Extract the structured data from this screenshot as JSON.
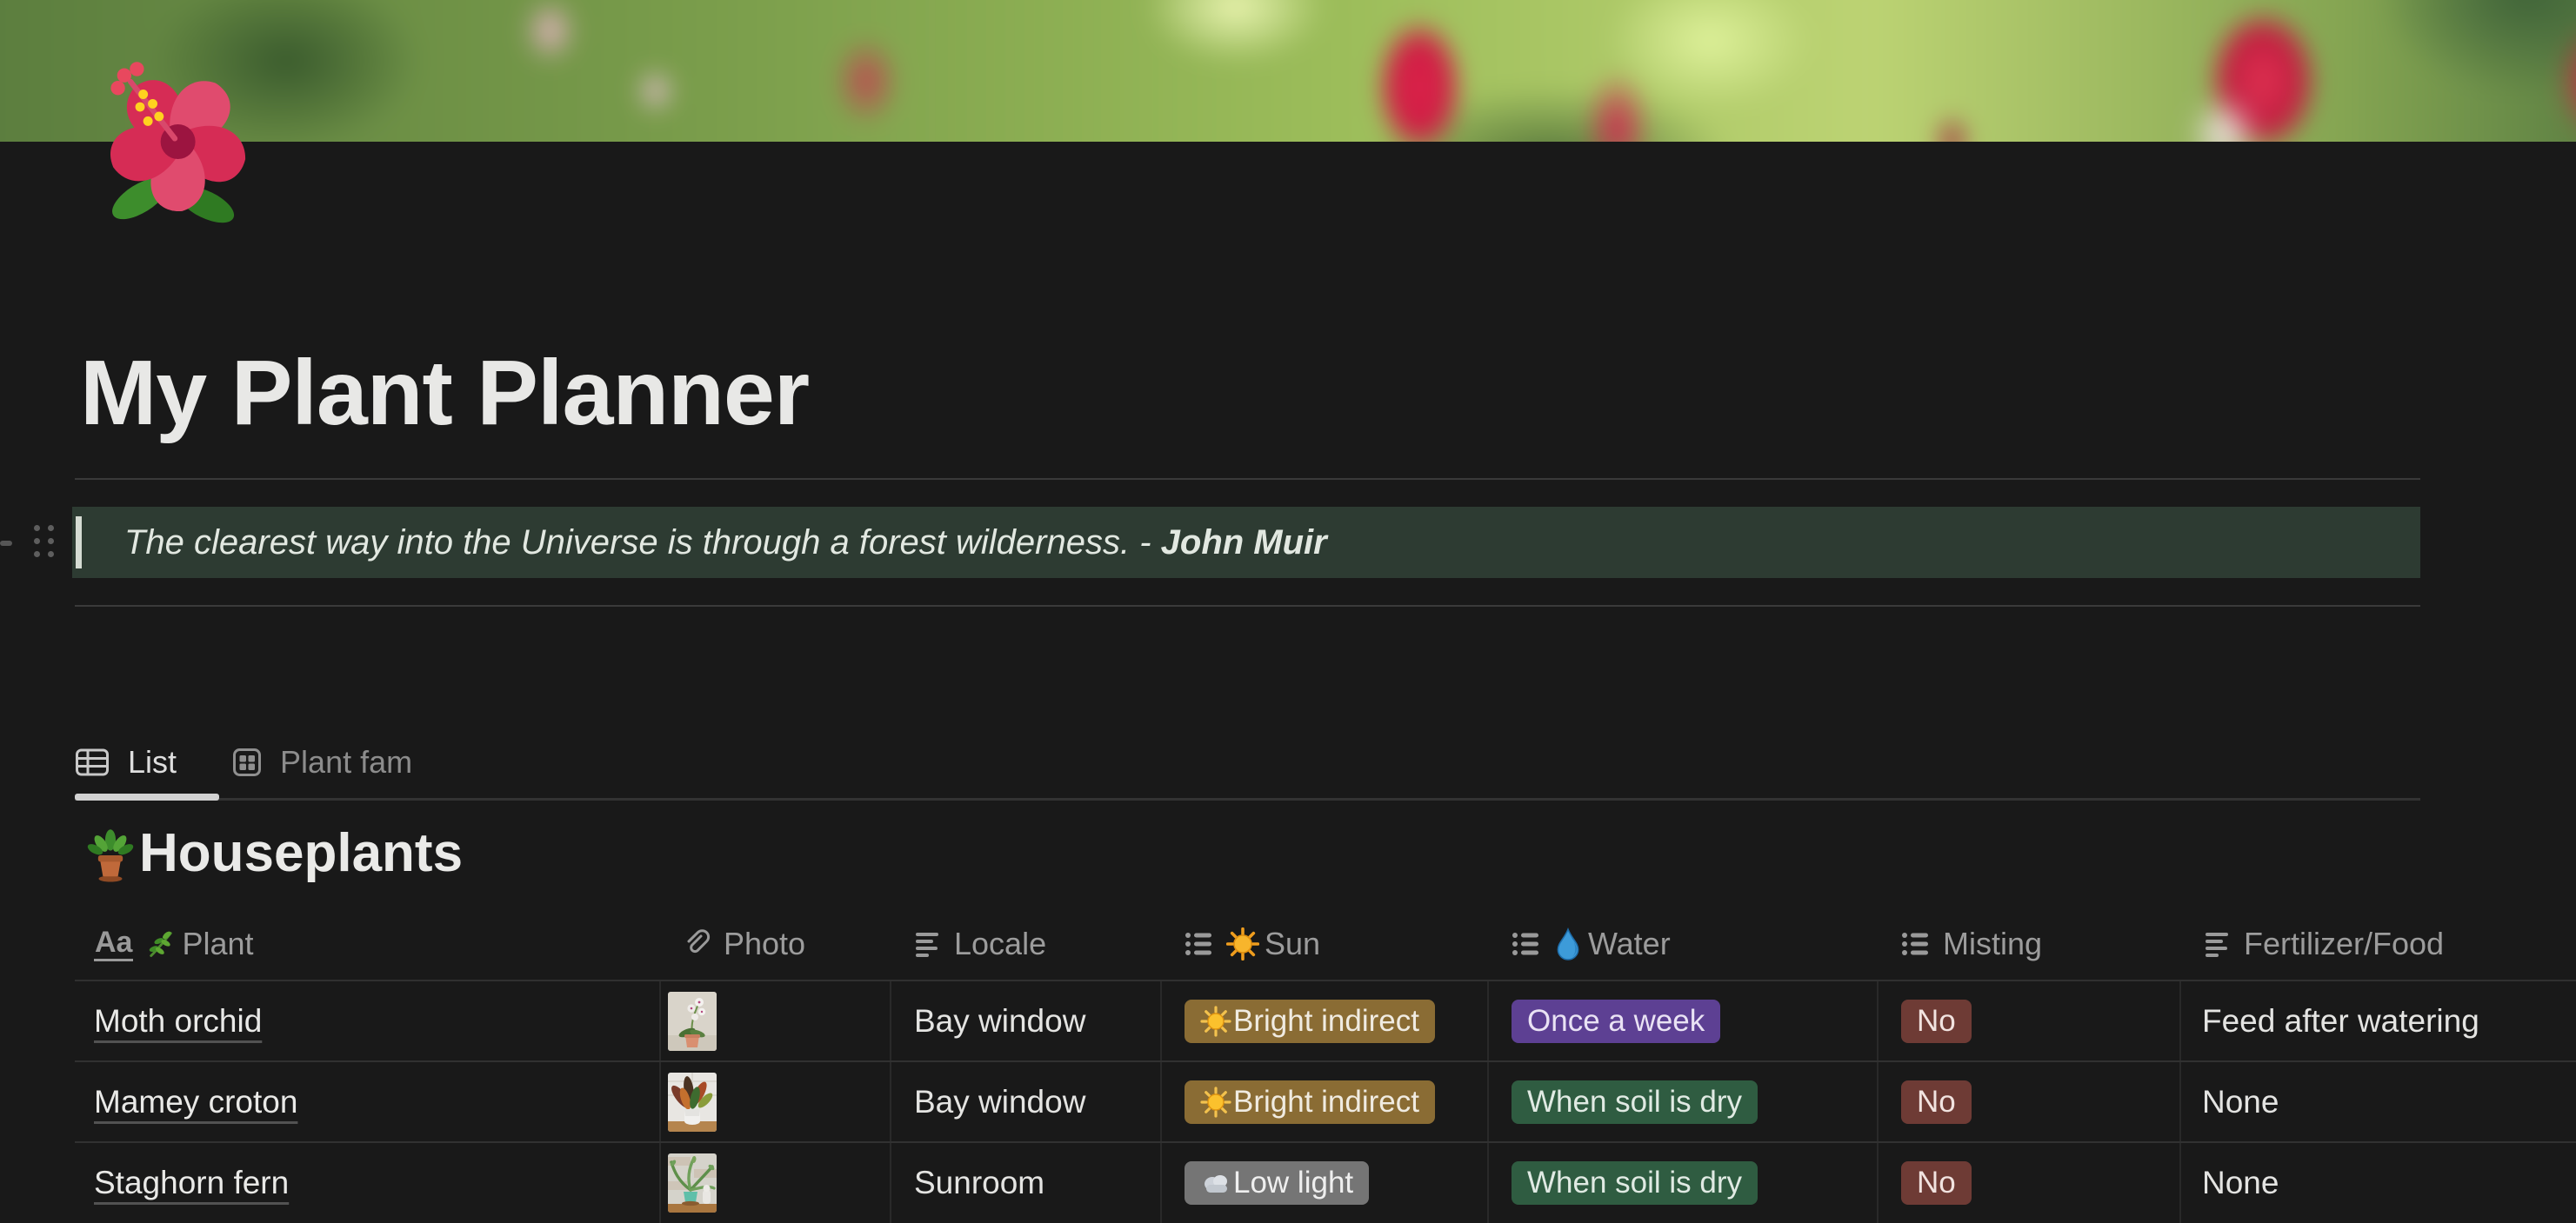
{
  "page": {
    "icon": "hibiscus-flower-emoji",
    "title": "My Plant Planner",
    "quote": {
      "text": "The clearest way into the Universe is through a forest wilderness.",
      "dash": " - ",
      "author": "John Muir"
    },
    "tabs": [
      {
        "label": "List",
        "icon": "table-view-icon",
        "active": true
      },
      {
        "label": "Plant fam",
        "icon": "board-view-icon",
        "active": false
      }
    ]
  },
  "database": {
    "icon": "potted-plant-emoji",
    "title": "Houseplants",
    "columns": [
      {
        "label": "Plant",
        "type_icon": "title-aa-icon",
        "emoji": "herb-leaf-emoji"
      },
      {
        "label": "Photo",
        "type_icon": "paperclip-icon"
      },
      {
        "label": "Locale",
        "type_icon": "text-lines-icon"
      },
      {
        "label": "Sun",
        "type_icon": "select-list-icon",
        "emoji": "sun-emoji"
      },
      {
        "label": "Water",
        "type_icon": "select-list-icon",
        "emoji": "droplet-emoji"
      },
      {
        "label": "Misting",
        "type_icon": "select-list-icon"
      },
      {
        "label": "Fertilizer/Food",
        "type_icon": "text-lines-icon"
      }
    ],
    "rows": [
      {
        "plant": "Moth orchid",
        "photo": "orchid-in-terracotta-pot-photo",
        "locale": "Bay window",
        "sun": {
          "label": "Bright indirect",
          "color": "yellow",
          "emoji": "sun-emoji"
        },
        "water": {
          "label": "Once a week",
          "color": "purple"
        },
        "misting": {
          "label": "No",
          "color": "red"
        },
        "fertilizer": "Feed after watering"
      },
      {
        "plant": "Mamey croton",
        "photo": "croton-in-white-pot-photo",
        "locale": "Bay window",
        "sun": {
          "label": "Bright indirect",
          "color": "yellow",
          "emoji": "sun-emoji"
        },
        "water": {
          "label": "When soil is dry",
          "color": "green"
        },
        "misting": {
          "label": "No",
          "color": "red"
        },
        "fertilizer": "None"
      },
      {
        "plant": "Staghorn fern",
        "photo": "staghorn-fern-in-teal-pot-photo",
        "locale": "Sunroom",
        "sun": {
          "label": "Low light",
          "color": "gray",
          "emoji": "cloud-emoji"
        },
        "water": {
          "label": "When soil is dry",
          "color": "green"
        },
        "misting": {
          "label": "No",
          "color": "red"
        },
        "fertilizer": "None"
      }
    ]
  },
  "colors": {
    "background": "#191919",
    "quote_background": "#2d3b32",
    "divider": "#3a3a3a",
    "header_text": "#9c9c9c",
    "tag_yellow": "#8a6c34",
    "tag_purple": "#5d4093",
    "tag_green": "#2f5c41",
    "tag_red": "#6e3b35",
    "tag_gray": "#757575"
  }
}
